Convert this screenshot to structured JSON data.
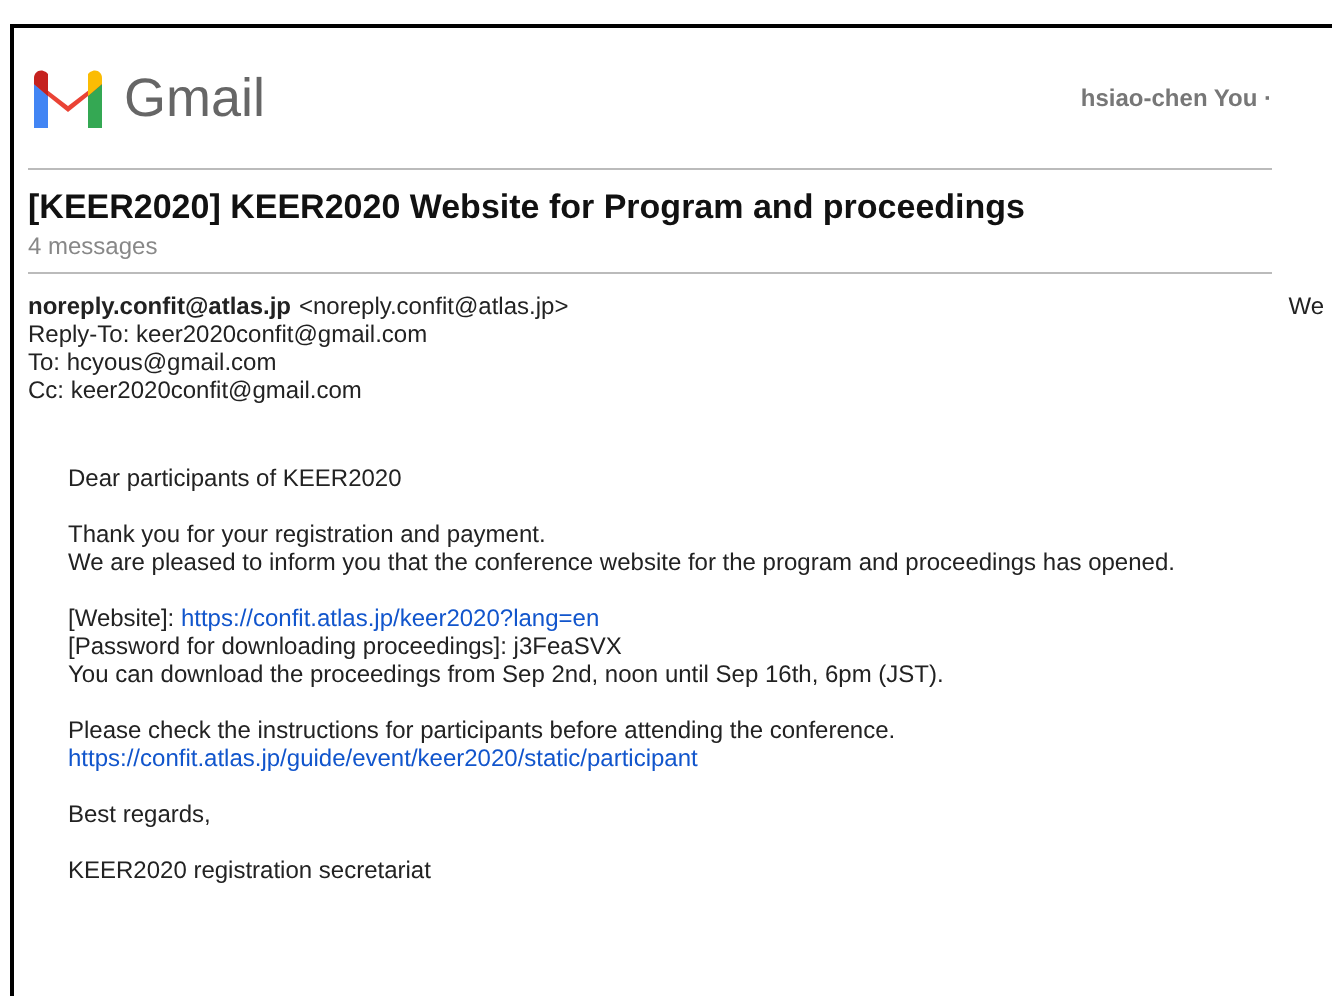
{
  "brand": {
    "name": "Gmail"
  },
  "account": "hsiao-chen You ·",
  "thread": {
    "subject": "[KEER2020] KEER2020 Website for Program and proceedings",
    "count": "4 messages"
  },
  "message": {
    "from_name": "noreply.confit@atlas.jp",
    "from_address": "<noreply.confit@atlas.jp>",
    "date": "We",
    "headers": [
      "Reply-To: keer2020confit@gmail.com",
      "To: hcyous@gmail.com",
      "Cc: keer2020confit@gmail.com"
    ],
    "paragraphs": [
      [
        [
          {
            "kind": "plain",
            "text": "Dear participants of KEER2020"
          }
        ]
      ],
      [
        [
          {
            "kind": "plain",
            "text": "Thank you for your registration and payment."
          }
        ],
        [
          {
            "kind": "plain",
            "text": "We are pleased to inform you that the conference website for the program and proceedings has opened."
          }
        ]
      ],
      [
        [
          {
            "kind": "plain",
            "text": "[Website]: "
          },
          {
            "kind": "link",
            "text": "https://confit.atlas.jp/keer2020?lang=en"
          }
        ],
        [
          {
            "kind": "plain",
            "text": "[Password for downloading proceedings]: j3FeaSVX"
          }
        ],
        [
          {
            "kind": "plain",
            "text": "You can download the proceedings from Sep 2nd, noon until Sep 16th, 6pm (JST)."
          }
        ]
      ],
      [
        [
          {
            "kind": "plain",
            "text": "Please check the instructions for participants before attending the conference."
          }
        ],
        [
          {
            "kind": "link",
            "text": "https://confit.atlas.jp/guide/event/keer2020/static/participant"
          }
        ]
      ],
      [
        [
          {
            "kind": "plain",
            "text": "Best regards,"
          }
        ]
      ],
      [
        [
          {
            "kind": "plain",
            "text": "KEER2020 registration secretariat"
          }
        ]
      ]
    ]
  }
}
